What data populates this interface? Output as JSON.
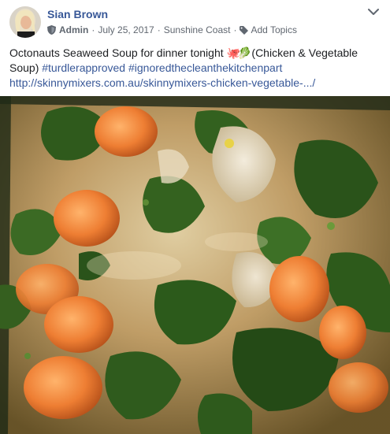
{
  "post": {
    "author": "Sian Brown",
    "role": "Admin",
    "date": "July 25, 2017",
    "location": "Sunshine Coast",
    "add_topics": "Add Topics",
    "separator": "·",
    "text_main": "Octonauts Seaweed Soup for dinner tonight ",
    "emoji_octopus": "🐙",
    "emoji_leaf": "🥬",
    "text_after_emoji": " (Chicken & Vegetable Soup) ",
    "hashtags": [
      "#turdlerapproved",
      "#ignoredthecleanthekitchenpart"
    ],
    "link": "http://skinnymixers.com.au/skinnymixers-chicken-vegetable-.../"
  },
  "icons": {
    "shield": "admin-shield-icon",
    "tag": "tag-icon",
    "chevron": "chevron-down-icon"
  },
  "colors": {
    "link": "#385898",
    "meta": "#606770",
    "text": "#1c1e21"
  }
}
